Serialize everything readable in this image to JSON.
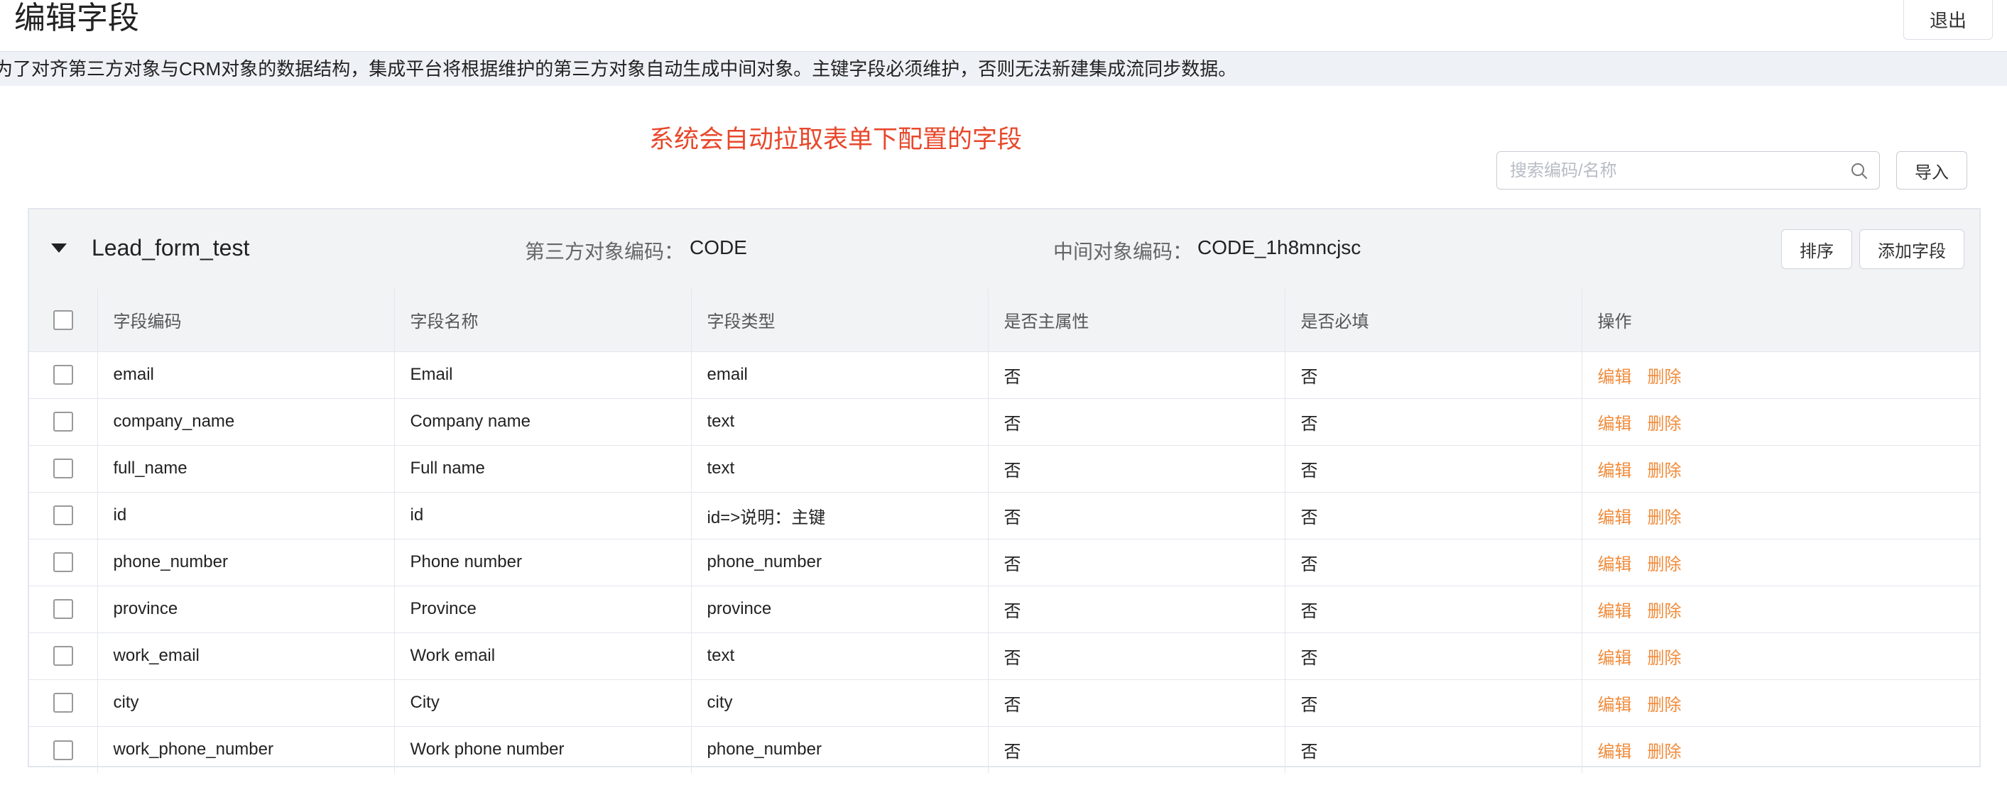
{
  "header": {
    "title": "编辑字段",
    "exit_label": "退出"
  },
  "notice": "为了对齐第三方对象与CRM对象的数据结构，集成平台将根据维护的第三方对象自动生成中间对象。主键字段必须维护，否则无法新建集成流同步数据。",
  "annotation": "系统会自动拉取表单下配置的字段",
  "toolbar": {
    "search_placeholder": "搜索编码/名称",
    "import_label": "导入"
  },
  "panel": {
    "form_name": "Lead_form_test",
    "third_party_label": "第三方对象编码：",
    "third_party_code": "CODE",
    "middle_label": "中间对象编码：",
    "middle_code": "CODE_1h8mncjsc",
    "sort_label": "排序",
    "add_field_label": "添加字段"
  },
  "table": {
    "columns": [
      "字段编码",
      "字段名称",
      "字段类型",
      "是否主属性",
      "是否必填",
      "操作"
    ],
    "edit_label": "编辑",
    "delete_label": "删除",
    "rows": [
      {
        "code": "email",
        "name": "Email",
        "type": "email",
        "primary": "否",
        "required": "否"
      },
      {
        "code": "company_name",
        "name": "Company name",
        "type": "text",
        "primary": "否",
        "required": "否"
      },
      {
        "code": "full_name",
        "name": "Full name",
        "type": "text",
        "primary": "否",
        "required": "否"
      },
      {
        "code": "id",
        "name": "id",
        "type": "id=>说明：主键",
        "primary": "否",
        "required": "否"
      },
      {
        "code": "phone_number",
        "name": "Phone number",
        "type": "phone_number",
        "primary": "否",
        "required": "否"
      },
      {
        "code": "province",
        "name": "Province",
        "type": "province",
        "primary": "否",
        "required": "否"
      },
      {
        "code": "work_email",
        "name": "Work email",
        "type": "text",
        "primary": "否",
        "required": "否"
      },
      {
        "code": "city",
        "name": "City",
        "type": "city",
        "primary": "否",
        "required": "否"
      },
      {
        "code": "work_phone_number",
        "name": "Work phone number",
        "type": "phone_number",
        "primary": "否",
        "required": "否"
      }
    ]
  },
  "colors": {
    "annotation": "#e8472b",
    "action_link": "#f08c3c",
    "notice_bg": "#eef1f6"
  }
}
